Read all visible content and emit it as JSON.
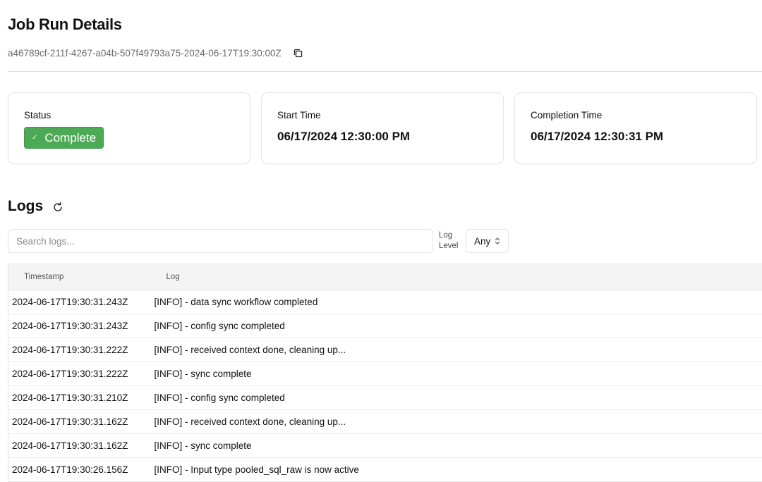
{
  "header": {
    "title": "Job Run Details",
    "run_id": "a46789cf-211f-4267-a04b-507f49793a75-2024-06-17T19:30:00Z",
    "copy_icon": "copy-icon"
  },
  "cards": {
    "status": {
      "label": "Status",
      "value": "Complete",
      "icon": "check-icon",
      "color": "#4caa55"
    },
    "start_time": {
      "label": "Start Time",
      "value": "06/17/2024 12:30:00 PM"
    },
    "completion_time": {
      "label": "Completion Time",
      "value": "06/17/2024 12:30:31 PM"
    }
  },
  "logs": {
    "title": "Logs",
    "refresh_icon": "refresh-icon",
    "search": {
      "placeholder": "Search logs...",
      "value": ""
    },
    "log_level": {
      "label_line1": "Log",
      "label_line2": "Level",
      "selected": "Any"
    },
    "columns": {
      "timestamp": "Timestamp",
      "log": "Log"
    },
    "rows": [
      {
        "timestamp": "2024-06-17T19:30:31.243Z",
        "log": "[INFO] - data sync workflow completed"
      },
      {
        "timestamp": "2024-06-17T19:30:31.243Z",
        "log": "[INFO] - config sync completed"
      },
      {
        "timestamp": "2024-06-17T19:30:31.222Z",
        "log": "[INFO] - received context done, cleaning up..."
      },
      {
        "timestamp": "2024-06-17T19:30:31.222Z",
        "log": "[INFO] - sync complete"
      },
      {
        "timestamp": "2024-06-17T19:30:31.210Z",
        "log": "[INFO] - config sync completed"
      },
      {
        "timestamp": "2024-06-17T19:30:31.162Z",
        "log": "[INFO] - received context done, cleaning up..."
      },
      {
        "timestamp": "2024-06-17T19:30:31.162Z",
        "log": "[INFO] - sync complete"
      },
      {
        "timestamp": "2024-06-17T19:30:26.156Z",
        "log": "[INFO] - Input type pooled_sql_raw is now active"
      }
    ]
  }
}
